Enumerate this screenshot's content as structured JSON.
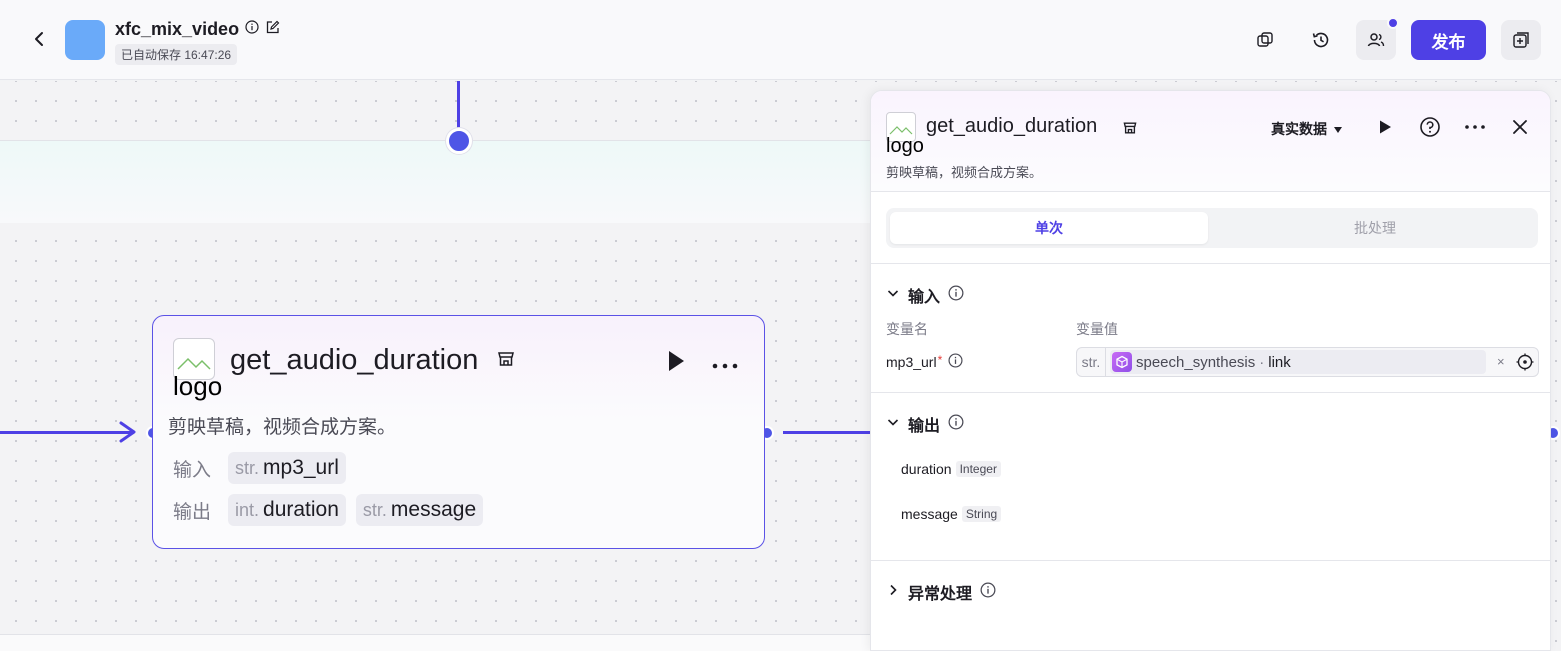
{
  "header": {
    "app_title": "xfc_mix_video",
    "save_status": "已自动保存 16:47:26",
    "publish_label": "发布"
  },
  "node": {
    "logo_alt": "logo",
    "title": "get_audio_duration",
    "description": "剪映草稿，视频合成方案。",
    "input_label": "输入",
    "output_label": "输出",
    "inputs": [
      {
        "type": "str.",
        "name": "mp3_url"
      }
    ],
    "outputs": [
      {
        "type": "int.",
        "name": "duration"
      },
      {
        "type": "str.",
        "name": "message"
      }
    ]
  },
  "panel": {
    "logo_alt": "logo",
    "title": "get_audio_duration",
    "description": "剪映草稿，视频合成方案。",
    "data_source": "真实数据",
    "tabs": [
      {
        "label": "单次",
        "active": true
      },
      {
        "label": "批处理",
        "active": false
      }
    ],
    "input_section": {
      "title": "输入",
      "col_name": "变量名",
      "col_value": "变量值",
      "params": [
        {
          "name": "mp3_url",
          "required": "*",
          "type": "str.",
          "ref_node": "speech_synthesis",
          "ref_sep": "·",
          "ref_field": "link",
          "clear": "×"
        }
      ]
    },
    "output_section": {
      "title": "输出",
      "fields": [
        {
          "name": "duration",
          "type": "Integer"
        },
        {
          "name": "message",
          "type": "String"
        }
      ]
    },
    "error_section": {
      "title": "异常处理"
    }
  },
  "colors": {
    "accent": "#4e40e5",
    "edge": "#4e55e6",
    "avatar": "#6aaaf9"
  }
}
